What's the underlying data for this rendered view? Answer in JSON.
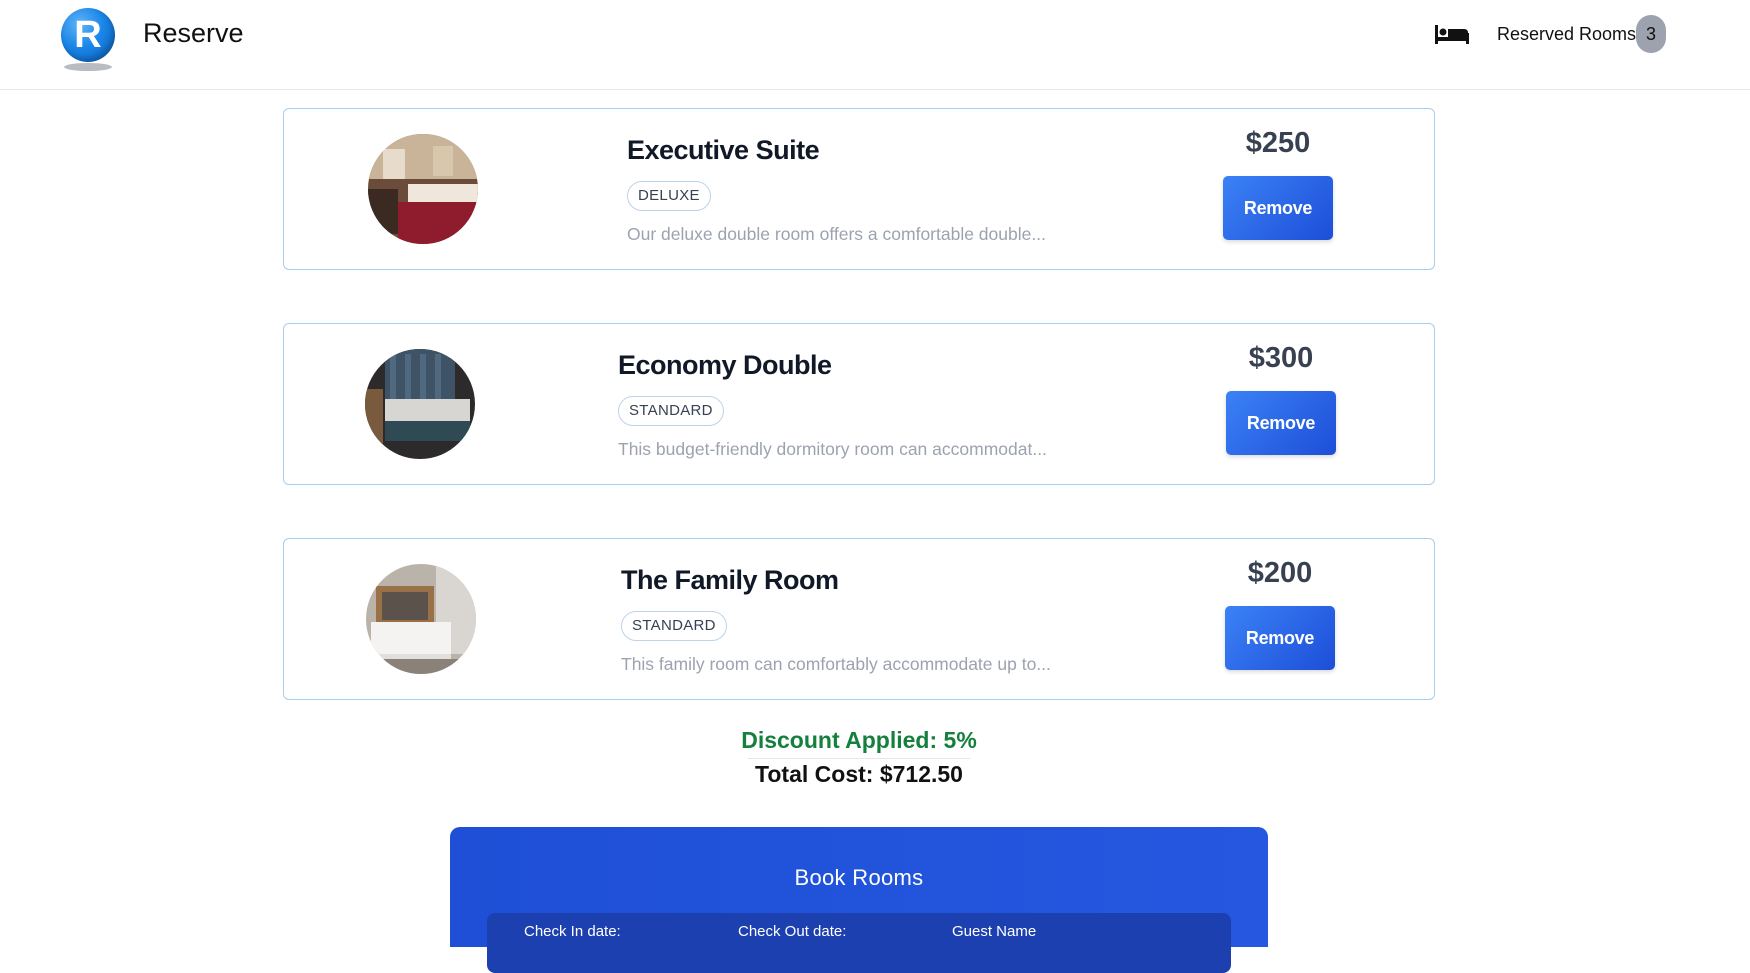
{
  "header": {
    "logo_letter": "R",
    "brand": "Reserve",
    "reserved_label": "Reserved Rooms:",
    "reserved_count": "3"
  },
  "rooms": [
    {
      "title": "Executive Suite",
      "tag": "DELUXE",
      "description": "Our deluxe double room offers a comfortable double...",
      "price": "$250",
      "action": "Remove"
    },
    {
      "title": "Economy Double",
      "tag": "STANDARD",
      "description": "This budget-friendly dormitory room can accommodat...",
      "price": "$300",
      "action": "Remove"
    },
    {
      "title": "The Family Room",
      "tag": "STANDARD",
      "description": "This family room can comfortably accommodate up to...",
      "price": "$200",
      "action": "Remove"
    }
  ],
  "summary": {
    "discount": "Discount Applied: 5%",
    "total": "Total Cost: $712.50"
  },
  "booking": {
    "title": "Book Rooms",
    "check_in_label": "Check In date:",
    "check_out_label": "Check Out date:",
    "guest_name_label": "Guest Name"
  },
  "colors": {
    "accent": "#1d4ed8",
    "discount": "#15803d",
    "card_border": "#a9cdee"
  }
}
